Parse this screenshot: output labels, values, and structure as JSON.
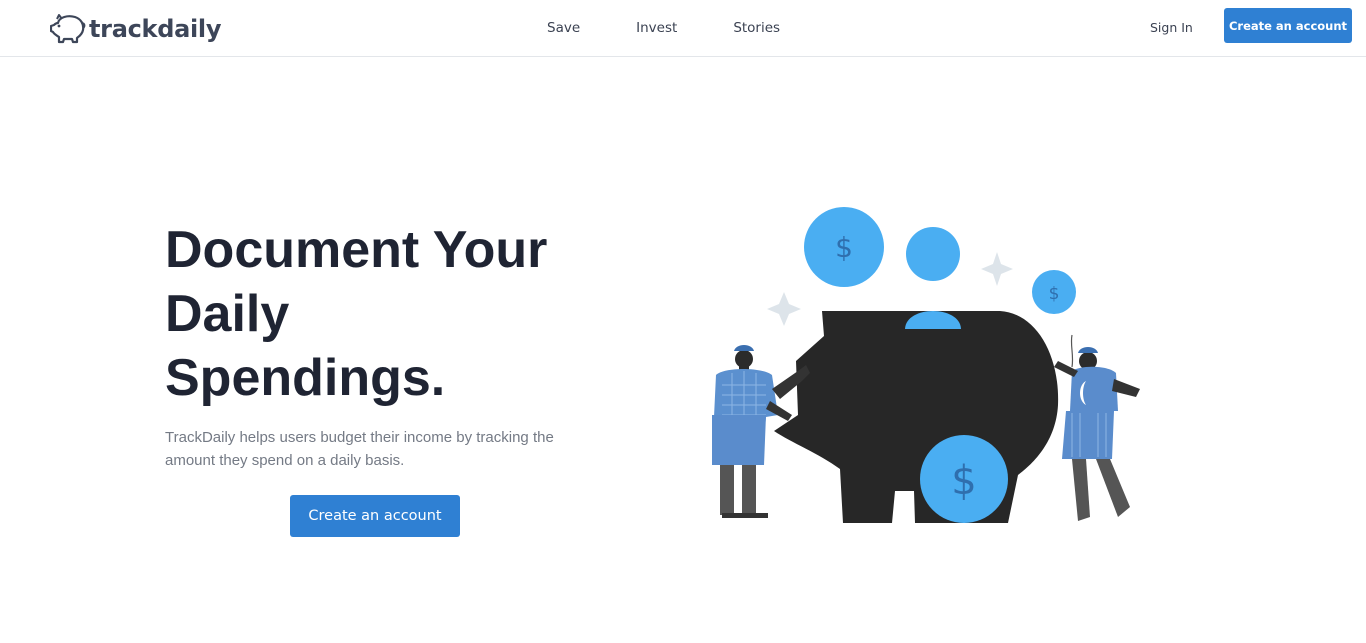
{
  "brand": {
    "name": "trackdaily",
    "icon": "piggy-bank-icon"
  },
  "nav": {
    "items": [
      "Save",
      "Invest",
      "Stories"
    ]
  },
  "auth": {
    "sign_in": "Sign In",
    "create_account": "Create an account"
  },
  "hero": {
    "title_lines": [
      "Document Your",
      "Daily",
      "Spendings."
    ],
    "description": "TrackDaily helps users budget their income by tracking the amount they spend on a daily basis.",
    "cta": "Create an account"
  },
  "illustration": {
    "coin_symbol": "$",
    "icons": [
      "piggy-bank-icon",
      "coin-icon",
      "sparkle-icon",
      "person-icon"
    ]
  },
  "colors": {
    "primary": "#2f80d3",
    "heading": "#1f2433",
    "body_text": "#747a85",
    "coin_blue": "#4aaef2",
    "piggy_dark": "#272727",
    "sparkle": "#dde4ea"
  }
}
